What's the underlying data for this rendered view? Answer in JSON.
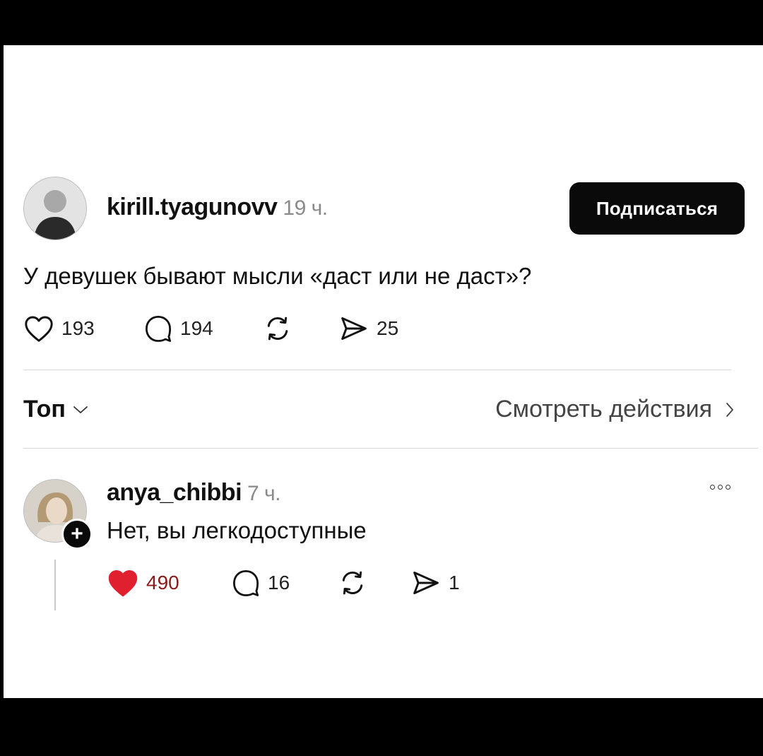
{
  "post": {
    "username": "kirill.tyagunovv",
    "time": "19 ч.",
    "follow_label": "Подписаться",
    "text": "У девушек бывают мысли «даст или не даст»?",
    "likes": "193",
    "comments": "194",
    "shares": "25"
  },
  "sort": {
    "label": "Топ",
    "activity_label": "Смотреть действия"
  },
  "reply": {
    "username": "anya_chibbi",
    "time": "7 ч.",
    "text": "Нет, вы легкодоступные",
    "likes": "490",
    "comments": "16",
    "shares": "1",
    "liked": true
  },
  "colors": {
    "button_bg": "#0a0a0a",
    "like_active": "#e0202e"
  },
  "icons": [
    "heart-icon",
    "comment-icon",
    "repost-icon",
    "send-icon",
    "chevron-down-icon",
    "chevron-right-icon",
    "plus-icon",
    "more-icon"
  ]
}
